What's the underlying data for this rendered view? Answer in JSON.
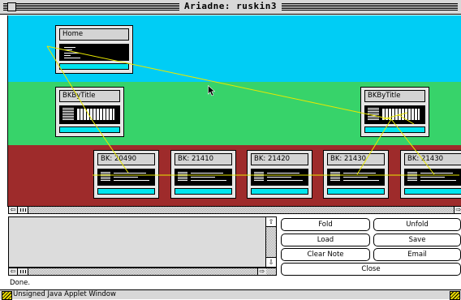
{
  "window": {
    "title": "Ariadne: ruskin3"
  },
  "canvas": {
    "bands": [
      {
        "name": "cyan",
        "color": "#00cdf5"
      },
      {
        "name": "green",
        "color": "#37d36a"
      },
      {
        "name": "red",
        "color": "#9e2b2b"
      }
    ],
    "link_color": "#e8e800",
    "nodes": [
      {
        "id": "home",
        "label": "Home"
      },
      {
        "id": "bkbytitle-1",
        "label": "BKByTitle"
      },
      {
        "id": "bkbytitle-2",
        "label": "BKByTitle"
      },
      {
        "id": "bk-20490",
        "label": "BK: 20490"
      },
      {
        "id": "bk-21410",
        "label": "BK: 21410"
      },
      {
        "id": "bk-21420",
        "label": "BK: 21420"
      },
      {
        "id": "bk-21430-a",
        "label": "BK: 21430"
      },
      {
        "id": "bk-21430-b",
        "label": "BK: 21430"
      }
    ]
  },
  "buttons": {
    "fold": "Fold",
    "unfold": "Unfold",
    "load": "Load",
    "save": "Save",
    "clear_note": "Clear Note",
    "email": "Email",
    "close": "Close"
  },
  "notes": {
    "value": ""
  },
  "status": {
    "text": "Done."
  },
  "bottom_bar": {
    "label": "Unsigned Java Applet Window"
  }
}
